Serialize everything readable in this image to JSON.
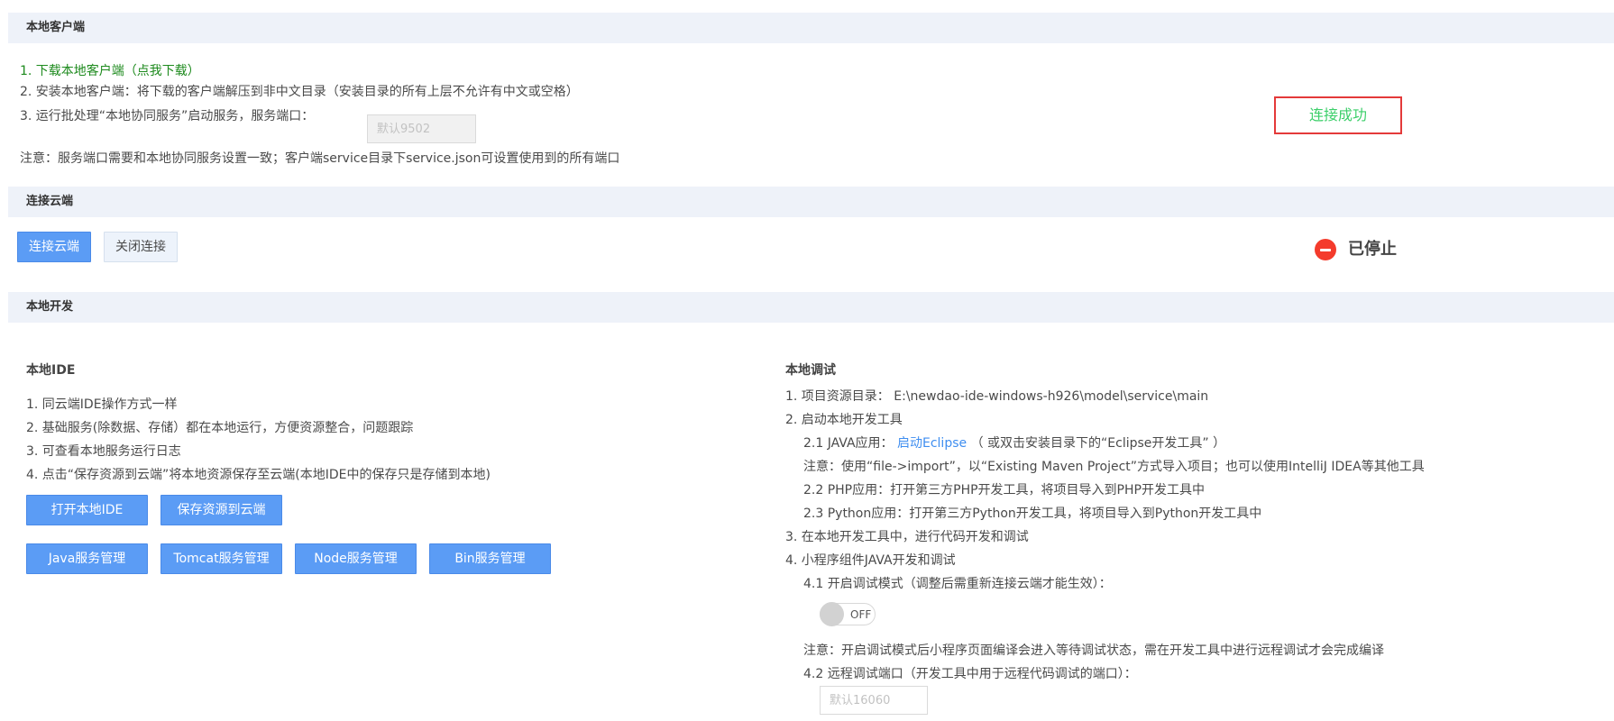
{
  "sections": {
    "local_client": "本地客户端",
    "cloud": "连接云端",
    "local_dev": "本地开发"
  },
  "client": {
    "step1": "1. 下载本地客户端（点我下载）",
    "step2": "2. 安装本地客户端：将下载的客户端解压到非中文目录（安装目录的所有上层不允许有中文或空格）",
    "step3": "3. 运行批处理“本地协同服务”启动服务，服务端口：",
    "port_placeholder": "默认9502",
    "note": "注意：服务端口需要和本地协同服务设置一致；客户端service目录下service.json可设置使用到的所有端口",
    "status": "连接成功"
  },
  "cloud": {
    "connect_label": "连接云端",
    "close_label": "关闭连接",
    "status": "已停止"
  },
  "ide": {
    "title": "本地IDE",
    "items": [
      "1. 同云端IDE操作方式一样",
      "2. 基础服务(除数据、存储）都在本地运行，方便资源整合，问题跟踪",
      "3. 可查看本地服务运行日志",
      "4. 点击“保存资源到云端”将本地资源保存至云端(本地IDE中的保存只是存储到本地)"
    ],
    "open_ide": "打开本地IDE",
    "save_cloud": "保存资源到云端",
    "java_mgmt": "Java服务管理",
    "tomcat_mgmt": "Tomcat服务管理",
    "node_mgmt": "Node服务管理",
    "bin_mgmt": "Bin服务管理"
  },
  "debug": {
    "title": "本地调试",
    "resource_dir": "1. 项目资源目录： E:\\newdao-ide-windows-h926\\model\\service\\main",
    "start_tools": "2. 启动本地开发工具",
    "java_prefix": "2.1 JAVA应用：",
    "java_link": "启动Eclipse",
    "java_suffix": "（ 或双击安装目录下的“Eclipse开发工具” ）",
    "java_note": "注意：使用“file->import”，以“Existing Maven Project”方式导入项目；也可以使用IntelliJ IDEA等其他工具",
    "php": "2.2 PHP应用：打开第三方PHP开发工具，将项目导入到PHP开发工具中",
    "python": "2.3 Python应用：打开第三方Python开发工具，将项目导入到Python开发工具中",
    "step3": "3. 在本地开发工具中，进行代码开发和调试",
    "step4": "4. 小程序组件JAVA开发和调试",
    "debug_mode": "4.1 开启调试模式（调整后需重新连接云端才能生效）：",
    "toggle_label": "OFF",
    "toggle_on": false,
    "debug_note": "注意：开启调试模式后小程序页面编译会进入等待调试状态，需在开发工具中进行远程调试才会完成编译",
    "remote_port": "4.2 远程调试端口（开发工具中用于远程代码调试的端口）：",
    "remote_port_placeholder": "默认16060"
  },
  "colors": {
    "accent": "#5b9cf5",
    "success": "#3ccf6a",
    "danger": "#f43b2c",
    "section_bg": "#eef2f9"
  }
}
